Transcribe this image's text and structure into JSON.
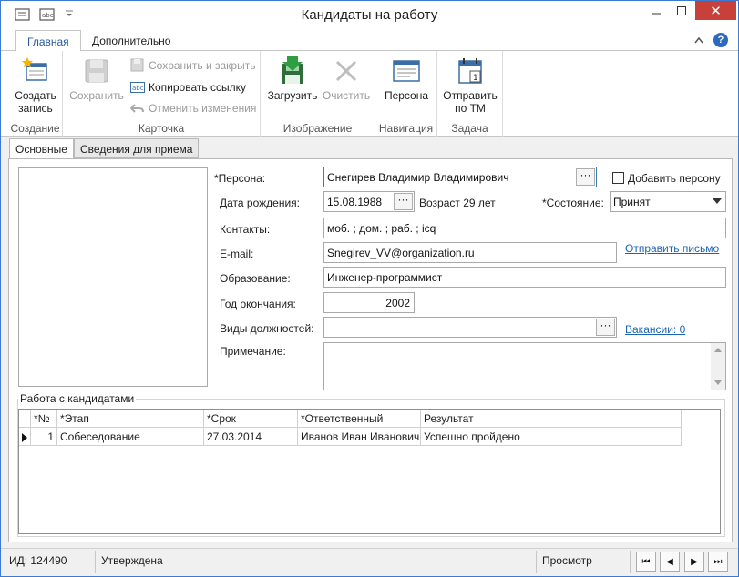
{
  "window": {
    "title": "Кандидаты на работу",
    "close_glyph": "✕",
    "help_glyph": "?"
  },
  "ribbon": {
    "tabs": [
      "Главная",
      "Дополнительно"
    ],
    "groups": {
      "create": {
        "label": "Создание",
        "create_button": "Создать запись"
      },
      "card": {
        "label": "Карточка",
        "save": "Сохранить",
        "save_close": "Сохранить и закрыть",
        "copy_link": "Копировать ссылку",
        "cancel_changes": "Отменить изменения"
      },
      "image": {
        "label": "Изображение",
        "load": "Загрузить",
        "clear": "Очистить"
      },
      "navigation": {
        "label": "Навигация",
        "person": "Персона"
      },
      "task": {
        "label": "Задача",
        "send_tm": "Отправить по ТМ"
      }
    }
  },
  "doc_tabs": [
    "Основные",
    "Сведения для приема"
  ],
  "form": {
    "person_label": "*Персона:",
    "person_value": "Снегирев Владимир Владимирович",
    "add_person_label": "Добавить персону",
    "birth_label": "Дата рождения:",
    "birth_value": "15.08.1988",
    "age_text": "Возраст 29 лет",
    "state_label": "*Состояние:",
    "state_value": "Принят",
    "contacts_label": "Контакты:",
    "contacts_value": "моб. ; дом. ; раб. ; icq",
    "email_label": "E-mail:",
    "email_value": "Snegirev_VV@organization.ru",
    "send_mail_link": "Отправить письмо",
    "education_label": "Образование:",
    "education_value": "Инженер-программист",
    "grad_year_label": "Год окончания:",
    "grad_year_value": "2002",
    "positions_label": "Виды должностей:",
    "positions_value": "",
    "vacancies_link": "Вакансии: 0",
    "note_label": "Примечание:",
    "note_value": "",
    "ellipsis": "···"
  },
  "candidates": {
    "group_title": "Работа с кандидатами",
    "columns": [
      "*№",
      "*Этап",
      "*Срок",
      "*Ответственный",
      "Результат"
    ],
    "rows": [
      {
        "num": "1",
        "stage": "Собеседование",
        "due": "27.03.2014",
        "responsible": "Иванов Иван Иванович",
        "result": "Успешно пройдено"
      }
    ]
  },
  "status": {
    "id": "ИД: 124490",
    "state": "Утверждена",
    "mode": "Просмотр",
    "nav": [
      "⏮",
      "◀",
      "▶",
      "⏭"
    ]
  },
  "colors": {
    "accent": "#2a5aa0",
    "close_button": "#c7413a",
    "link": "#1a64b4"
  }
}
